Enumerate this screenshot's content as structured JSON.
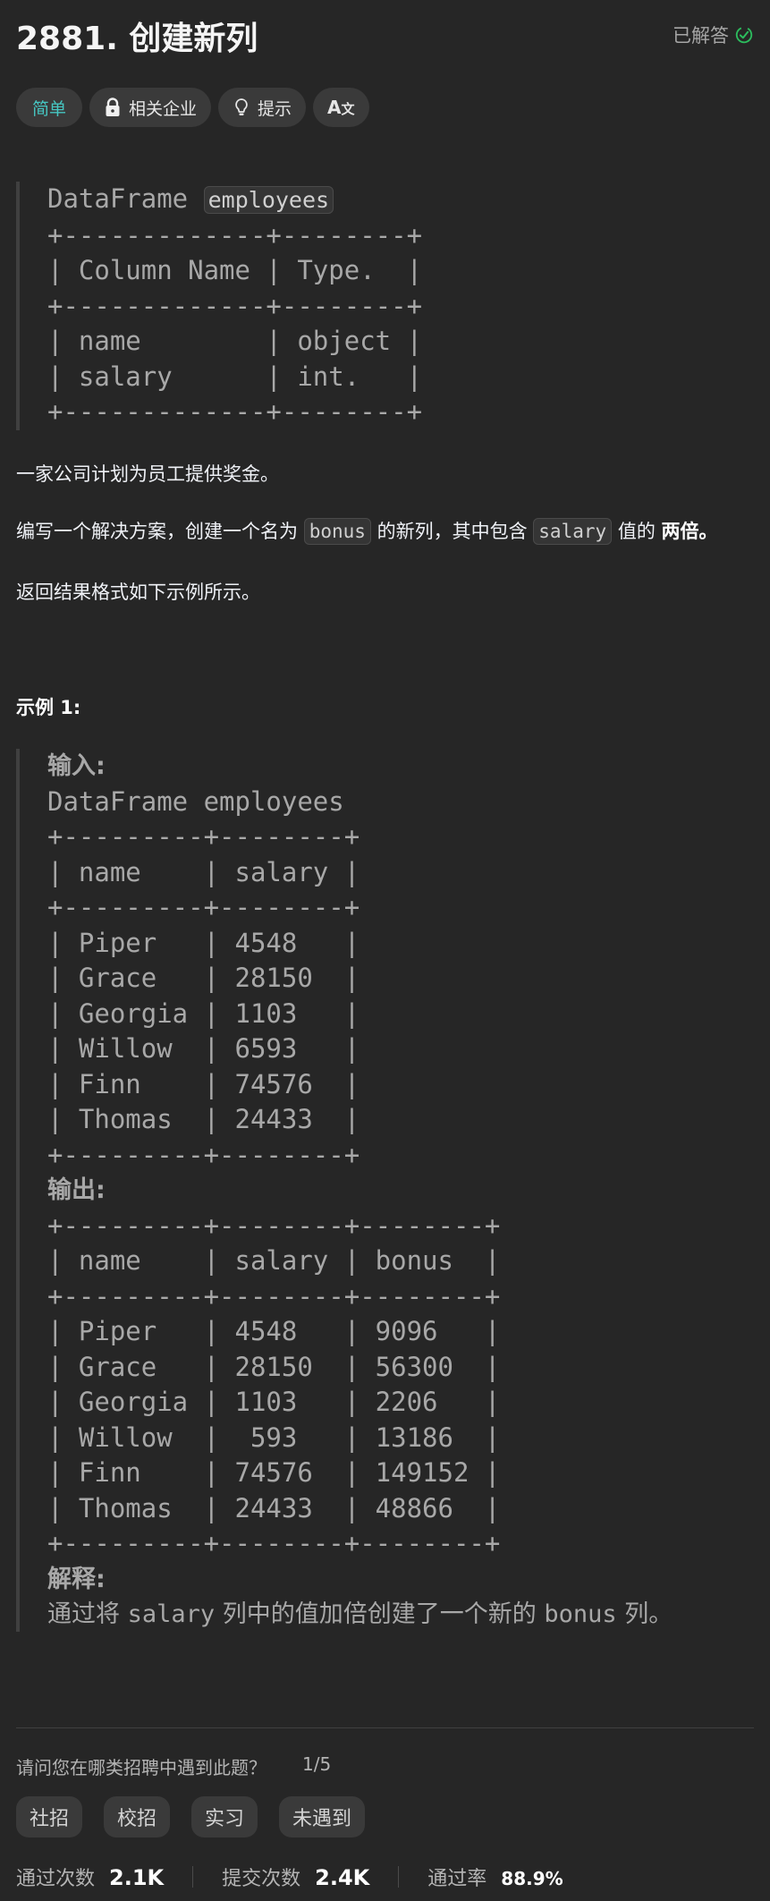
{
  "header": {
    "title": "2881. 创建新列",
    "status_label": "已解答",
    "status_color": "#2cbb5d"
  },
  "tags": {
    "difficulty": "简单",
    "difficulty_color": "#46c6c2",
    "companies": "相关企业",
    "hints": "提示",
    "translate": "A文"
  },
  "schema": {
    "prefix": "DataFrame",
    "name": "employees",
    "table": "+-------------+--------+\n| Column Name | Type.  |\n+-------------+--------+\n| name        | object |\n| salary      | int.   |\n+-------------+--------+"
  },
  "description": {
    "p1": "一家公司计划为员工提供奖金。",
    "p2_a": "编写一个解决方案，创建一个名为",
    "p2_code1": "bonus",
    "p2_b": "的新列，其中包含",
    "p2_code2": "salary",
    "p2_c": "值的",
    "p2_bold": "两倍。",
    "p3": "返回结果格式如下示例所示。"
  },
  "example": {
    "title": "示例 1:",
    "input_label": "输入:",
    "input_table": "DataFrame employees\n+---------+--------+\n| name    | salary |\n+---------+--------+\n| Piper   | 4548   |\n| Grace   | 28150  |\n| Georgia | 1103   |\n| Willow  | 6593   |\n| Finn    | 74576  |\n| Thomas  | 24433  |\n+---------+--------+",
    "output_label": "输出:",
    "output_table": "+---------+--------+--------+\n| name    | salary | bonus  |\n+---------+--------+--------+\n| Piper   | 4548   | 9096   |\n| Grace   | 28150  | 56300  |\n| Georgia | 1103   | 2206   |\n| Willow  |  593   | 13186  |\n| Finn    | 74576  | 149152 |\n| Thomas  | 24433  | 48866  |\n+---------+--------+--------+",
    "explanation_label": "解释:",
    "explanation_a": "通过将",
    "explanation_code1": "salary",
    "explanation_b": "列中的值加倍创建了一个新的",
    "explanation_code2": "bonus",
    "explanation_c": "列。"
  },
  "survey": {
    "question": "请问您在哪类招聘中遇到此题？",
    "progress": "1/5",
    "options": [
      "社招",
      "校招",
      "实习",
      "未遇到"
    ]
  },
  "stats": {
    "accepted_label": "通过次数",
    "accepted_value": "2.1K",
    "submissions_label": "提交次数",
    "submissions_value": "2.4K",
    "rate_label": "通过率",
    "rate_value": "88.9%"
  }
}
